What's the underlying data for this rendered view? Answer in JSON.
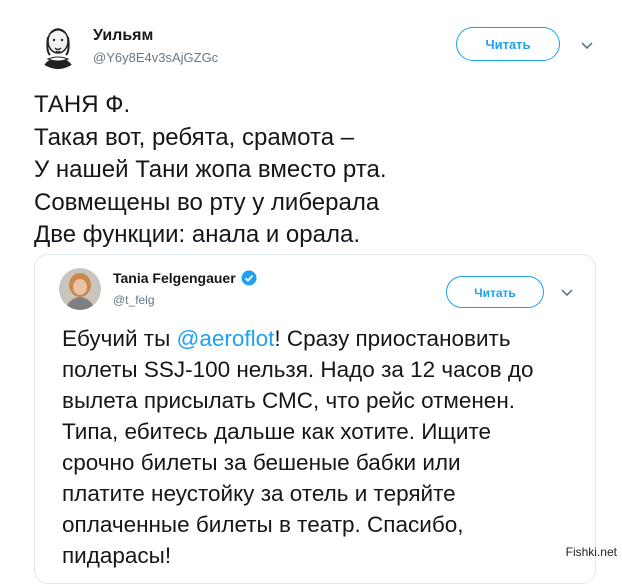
{
  "tweet": {
    "author_name": "Уильям",
    "author_handle": "@Y6y8E4v3sAjGZGc",
    "follow_label": "Читать",
    "poem_lines": [
      "ТАНЯ Ф.",
      "Такая вот, ребята, срамота –",
      "У нашей Тани жопа вместо рта.",
      "Совмещены во рту у либерала",
      "Две функции: анала и орала."
    ]
  },
  "quoted_tweet": {
    "author_name": "Tania Felgengauer",
    "author_handle": "@t_felg",
    "follow_label": "Читать",
    "line1_before": "Ебучий ты ",
    "line1_mention": "@aeroflot",
    "line1_after": "! Сразу приостановить",
    "lines": [
      "полеты SSJ-100 нельзя. Надо за 12 часов до",
      "вылета присылать СМС, что рейс отменен.",
      "Типа, ебитесь дальше как хотите. Ищите",
      "срочно билеты за бешеные бабки или",
      "платите неустойку за отель и теряйте",
      "оплаченные билеты в театр. Спасибо,",
      "пидарасы!"
    ]
  },
  "watermark": "Fishki.net",
  "colors": {
    "accent": "#1da1f2",
    "text": "#14171a",
    "muted": "#657786",
    "border": "#e1e8ed"
  }
}
